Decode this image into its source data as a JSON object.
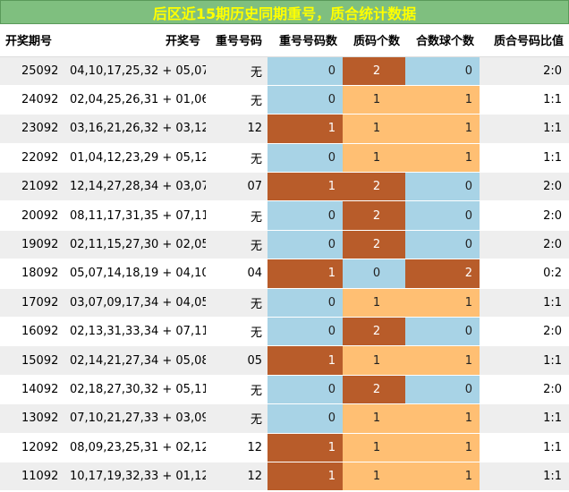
{
  "title": "后区近15期历史同期重号，质合统计数据",
  "headers": [
    "开奖期号",
    "开奖号",
    "重号号码",
    "重号号码数",
    "质码个数",
    "合数球个数",
    "质合号码比值"
  ],
  "rows": [
    {
      "issue": "25092",
      "numbers": "04,10,17,25,32 + 05,07",
      "repeat": "无",
      "repeat_count": "0",
      "prime_count": "2",
      "composite_count": "0",
      "ratio": "2:0"
    },
    {
      "issue": "24092",
      "numbers": "02,04,25,26,31 + 01,06",
      "repeat": "无",
      "repeat_count": "0",
      "prime_count": "1",
      "composite_count": "1",
      "ratio": "1:1"
    },
    {
      "issue": "23092",
      "numbers": "03,16,21,26,32 + 03,12",
      "repeat": "12",
      "repeat_count": "1",
      "prime_count": "1",
      "composite_count": "1",
      "ratio": "1:1"
    },
    {
      "issue": "22092",
      "numbers": "01,04,12,23,29 + 05,12",
      "repeat": "无",
      "repeat_count": "0",
      "prime_count": "1",
      "composite_count": "1",
      "ratio": "1:1"
    },
    {
      "issue": "21092",
      "numbers": "12,14,27,28,34 + 03,07",
      "repeat": "07",
      "repeat_count": "1",
      "prime_count": "2",
      "composite_count": "0",
      "ratio": "2:0"
    },
    {
      "issue": "20092",
      "numbers": "08,11,17,31,35 + 07,11",
      "repeat": "无",
      "repeat_count": "0",
      "prime_count": "2",
      "composite_count": "0",
      "ratio": "2:0"
    },
    {
      "issue": "19092",
      "numbers": "02,11,15,27,30 + 02,05",
      "repeat": "无",
      "repeat_count": "0",
      "prime_count": "2",
      "composite_count": "0",
      "ratio": "2:0"
    },
    {
      "issue": "18092",
      "numbers": "05,07,14,18,19 + 04,10",
      "repeat": "04",
      "repeat_count": "1",
      "prime_count": "0",
      "composite_count": "2",
      "ratio": "0:2"
    },
    {
      "issue": "17092",
      "numbers": "03,07,09,17,34 + 04,05",
      "repeat": "无",
      "repeat_count": "0",
      "prime_count": "1",
      "composite_count": "1",
      "ratio": "1:1"
    },
    {
      "issue": "16092",
      "numbers": "02,13,31,33,34 + 07,11",
      "repeat": "无",
      "repeat_count": "0",
      "prime_count": "2",
      "composite_count": "0",
      "ratio": "2:0"
    },
    {
      "issue": "15092",
      "numbers": "02,14,21,27,34 + 05,08",
      "repeat": "05",
      "repeat_count": "1",
      "prime_count": "1",
      "composite_count": "1",
      "ratio": "1:1"
    },
    {
      "issue": "14092",
      "numbers": "02,18,27,30,32 + 05,11",
      "repeat": "无",
      "repeat_count": "0",
      "prime_count": "2",
      "composite_count": "0",
      "ratio": "2:0"
    },
    {
      "issue": "13092",
      "numbers": "07,10,21,27,33 + 03,09",
      "repeat": "无",
      "repeat_count": "0",
      "prime_count": "1",
      "composite_count": "1",
      "ratio": "1:1"
    },
    {
      "issue": "12092",
      "numbers": "08,09,23,25,31 + 02,12",
      "repeat": "12",
      "repeat_count": "1",
      "prime_count": "1",
      "composite_count": "1",
      "ratio": "1:1"
    },
    {
      "issue": "11092",
      "numbers": "10,17,19,32,33 + 01,12",
      "repeat": "12",
      "repeat_count": "1",
      "prime_count": "1",
      "composite_count": "1",
      "ratio": "1:1"
    }
  ],
  "colors": {
    "title_bg": "#7fbf7f",
    "title_text": "#ffff00",
    "light_blue": "#a8d3e6",
    "peach": "#ffbf73",
    "brown": "#b85c2a"
  }
}
